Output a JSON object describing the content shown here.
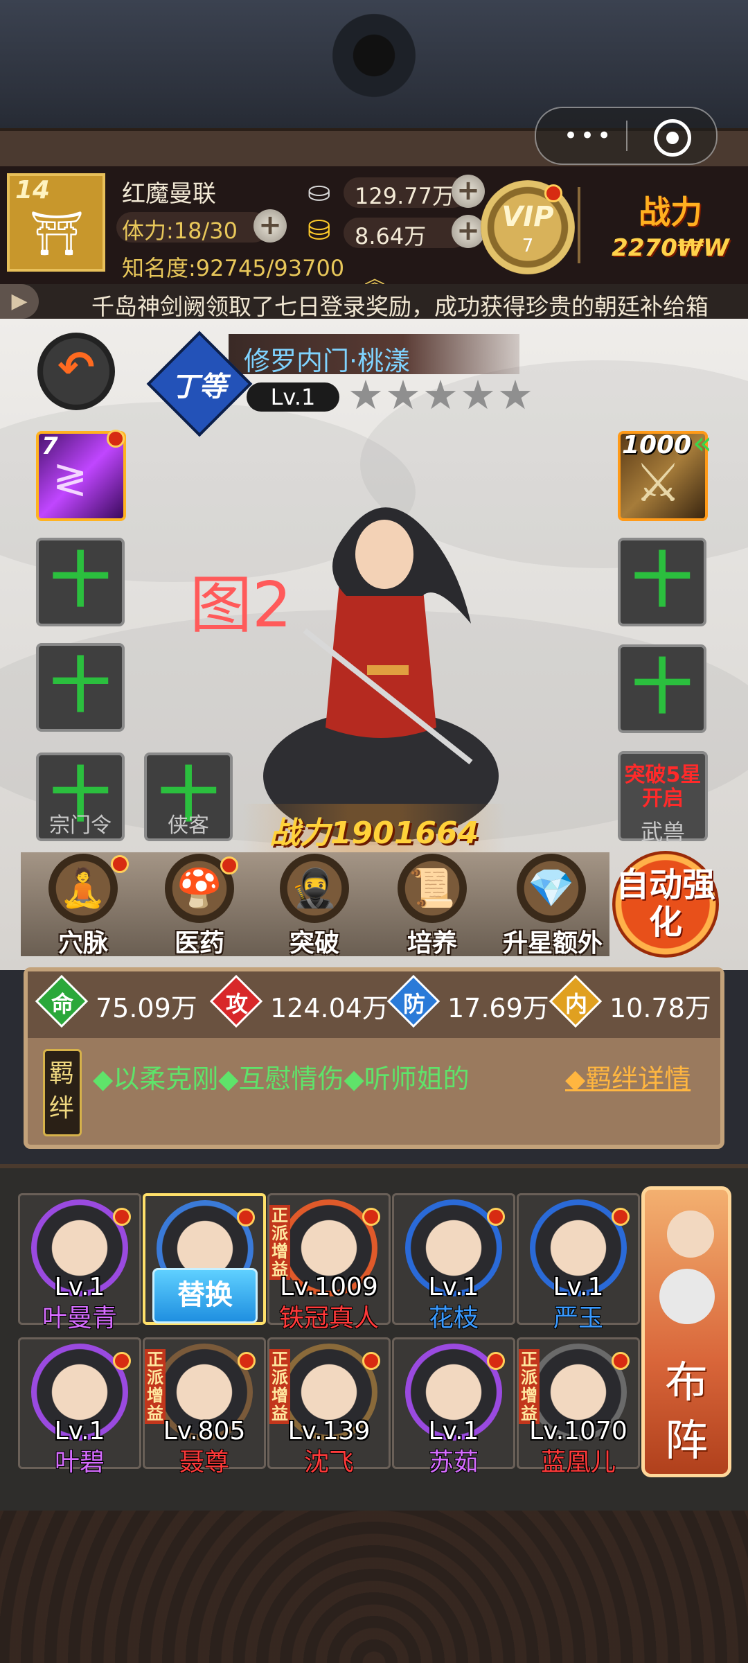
{
  "capsule": {
    "more_icon": "more-dots-icon",
    "close_icon": "target-icon"
  },
  "header": {
    "level": "14",
    "player_name": "红魔曼联",
    "stamina": "体力:18/30",
    "fame": "知名度:92745/93700",
    "silver": "129.77万",
    "gold": "8.64万",
    "vip_label": "VIP",
    "vip_level": "7",
    "power_label": "战力",
    "power_value": "2270₩W"
  },
  "ticker": {
    "message": "千岛神剑阙领取了七日登录奖励，成功获得珍贵的朝廷补给箱"
  },
  "hero": {
    "rank_badge": "丁等",
    "name": "修罗内门·桃漾",
    "level": "Lv.1",
    "stars": "★★★★★",
    "watermark": "图2",
    "power": "战力1901664"
  },
  "slots": {
    "skill_level": "7",
    "weapon_level": "1000",
    "add_symbol": "十",
    "sect_token": "宗门令",
    "companion": "侠客",
    "beast_lock": "突破5星开启",
    "beast": "武兽"
  },
  "actions": [
    {
      "label": "穴脉",
      "icon": "meridian-icon"
    },
    {
      "label": "医药",
      "icon": "medicine-icon"
    },
    {
      "label": "突破",
      "icon": "breakthrough-icon"
    },
    {
      "label": "培养",
      "icon": "scroll-icon"
    },
    {
      "label": "升星额外",
      "icon": "star-up-icon"
    }
  ],
  "auto_strengthen": "自动强化",
  "stats": [
    {
      "glyph": "命",
      "value": "75.09万",
      "color": "#2aa83a"
    },
    {
      "glyph": "攻",
      "value": "124.04万",
      "color": "#d8282a"
    },
    {
      "glyph": "防",
      "value": "17.69万",
      "color": "#2a7ad8"
    },
    {
      "glyph": "内",
      "value": "10.78万",
      "color": "#e0a020"
    }
  ],
  "bonds": {
    "tag": "羁绊",
    "list": "◆以柔克刚◆互慰情伤◆听师姐的",
    "detail": "◆羁绊详情"
  },
  "team": [
    {
      "level": "Lv.1",
      "name": "叶曼青",
      "name_color": "#d66cff",
      "ring": "#9a4ae0"
    },
    {
      "level": "",
      "name": "",
      "name_color": "#ffffff",
      "ring": "#3a7ad8",
      "swap": "替换"
    },
    {
      "level": "Lv.1009",
      "name": "铁冠真人",
      "name_color": "#ff3a3a",
      "ring": "#e05a2a",
      "tag": "正派增益"
    },
    {
      "level": "Lv.1",
      "name": "花枝",
      "name_color": "#3a9aff",
      "ring": "#2a6ad8"
    },
    {
      "level": "Lv.1",
      "name": "严玉",
      "name_color": "#3a9aff",
      "ring": "#2a6ad8"
    },
    {
      "level": "Lv.1",
      "name": "叶碧",
      "name_color": "#d66cff",
      "ring": "#9a4ae0"
    },
    {
      "level": "Lv.805",
      "name": "聂尊",
      "name_color": "#ff3a3a",
      "ring": "#7a5a3a",
      "tag": "正派增益"
    },
    {
      "level": "Lv.139",
      "name": "沈飞",
      "name_color": "#ff3a3a",
      "ring": "#8a6a3a",
      "tag": "正派增益"
    },
    {
      "level": "Lv.1",
      "name": "苏茹",
      "name_color": "#d66cff",
      "ring": "#9a4ae0"
    },
    {
      "level": "Lv.1070",
      "name": "蓝凰儿",
      "name_color": "#ff3a3a",
      "ring": "#6a6a6a",
      "tag": "正派增益"
    }
  ],
  "formation": "布阵"
}
